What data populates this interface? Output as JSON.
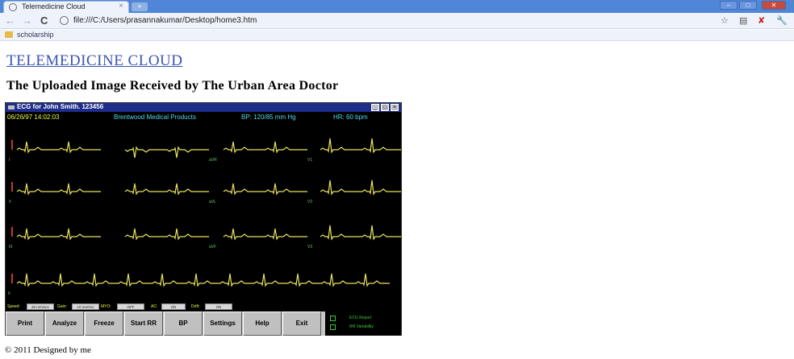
{
  "browser": {
    "tab_title": "Telemedicine Cloud",
    "tab_close": "×",
    "new_tab": "+",
    "url": "file:///C:/Users/prasannakumar/Desktop/home3.htm",
    "bookmark": "scholarship",
    "icons": [
      "back-icon",
      "forward-icon",
      "reload-icon",
      "page-icon",
      "star-icon",
      "page-menu-icon",
      "mcafee-icon",
      "wrench-icon"
    ]
  },
  "page": {
    "heading": "TELEMEDICINE CLOUD",
    "subheading": "The Uploaded Image Received by The Urban Area Doctor",
    "footer": "© 2011 Designed by me"
  },
  "ecg": {
    "title": "ECG for John Smith. 123456",
    "datetime": "06/26/97 14:02:03",
    "company": "Brentwood Medical Products",
    "bp": "BP:  120/85 mm Hg",
    "hr": "HR:  60 bpm",
    "lead_labels": [
      "I",
      "aVR",
      "V1",
      "V4",
      "II",
      "aVL",
      "V2",
      "V5",
      "III",
      "aVF",
      "V3",
      "V6",
      "II"
    ],
    "controls": {
      "speed_label": "Speed:",
      "speed_value": "25 mm/sec",
      "gain_label": "Gain:",
      "gain_value": "10 mm/mv",
      "myo_label": "MYO:",
      "myo_value": "OFF",
      "ac_label": "AC:",
      "ac_value": "ON",
      "drift_label": "Drift:",
      "drift_value": "ON"
    },
    "buttons": [
      "Print",
      "Analyze",
      "Freeze",
      "Start RR",
      "BP",
      "Settings",
      "Help",
      "Exit"
    ],
    "side_options": [
      "ECG Report",
      "RR Variability"
    ],
    "colors": {
      "trace": "#e9e35a",
      "background": "#000000",
      "label": "#6cc96c",
      "status": "#4fd7e8",
      "marker": "#c0392b"
    }
  }
}
